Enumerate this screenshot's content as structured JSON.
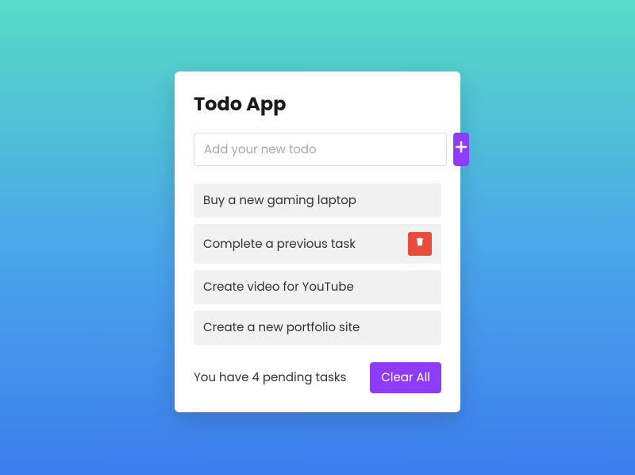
{
  "title": "Todo App",
  "input": {
    "placeholder": "Add your new todo",
    "value": ""
  },
  "todos": [
    {
      "text": "Buy a new gaming laptop",
      "showDelete": false
    },
    {
      "text": "Complete a previous task",
      "showDelete": true
    },
    {
      "text": "Create video for YouTube",
      "showDelete": false
    },
    {
      "text": "Create a new portfolio site",
      "showDelete": false
    }
  ],
  "footer": {
    "pending_text": "You have 4 pending tasks",
    "clear_label": "Clear All"
  },
  "colors": {
    "accent": "#8e3cf7",
    "danger": "#e74c3c"
  }
}
